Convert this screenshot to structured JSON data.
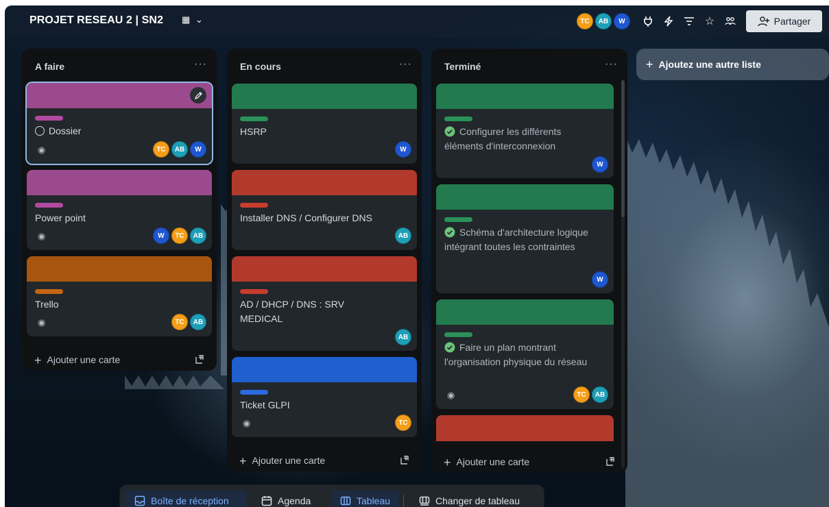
{
  "header": {
    "board_title": "PROJET RESEAU 2 | SN2",
    "members": [
      {
        "initials": "TC",
        "color": "#f59e17"
      },
      {
        "initials": "AB",
        "color": "#1e9fb8"
      },
      {
        "initials": "W",
        "color": "#1f57d1"
      }
    ],
    "share_label": "Partager"
  },
  "lists": [
    {
      "title": "A faire",
      "add_card_label": "Ajouter une carte",
      "cards": [
        {
          "title": "Dossier",
          "cover": "#9c4a8e",
          "label": "#b04aa0",
          "members": [
            "TC",
            "AB",
            "W"
          ]
        },
        {
          "title": "Power point",
          "cover": "#9c4a8e",
          "label": "#b04aa0",
          "members": [
            "W",
            "TC",
            "AB"
          ]
        },
        {
          "title": "Trello",
          "cover": "#a8560f",
          "label": "#c46412",
          "members": [
            "TC",
            "AB"
          ]
        }
      ]
    },
    {
      "title": "En cours",
      "add_card_label": "Ajouter une carte",
      "cards": [
        {
          "title": "HSRP",
          "cover": "#227a4e",
          "label": "#2a9158",
          "members": [
            "W"
          ]
        },
        {
          "title": "Installer DNS / Configurer DNS",
          "cover": "#b13a2d",
          "label": "#c73d2e",
          "members": [
            "AB"
          ]
        },
        {
          "title": "AD / DHCP / DNS : SRV MEDICAL",
          "cover": "#b13a2d",
          "label": "#c73d2e",
          "members": [
            "AB"
          ]
        },
        {
          "title": "Ticket GLPI",
          "cover": "#1f5fce",
          "label": "#2b6ae0",
          "members": [
            "TC"
          ]
        }
      ]
    },
    {
      "title": "Terminé",
      "add_card_label": "Ajouter une carte",
      "cards": [
        {
          "title": "Configurer les différents éléments d'interconnexion",
          "cover": "#227a4e",
          "label": "#2a9158",
          "members": [
            "W"
          ]
        },
        {
          "title": "Schéma d'architecture logique intégrant toutes les contraintes",
          "cover": "#227a4e",
          "label": "#2a9158",
          "members": [
            "W"
          ]
        },
        {
          "title": "Faire un plan montrant l'organisation physique du réseau",
          "cover": "#227a4e",
          "label": "#2a9158",
          "members": [
            "TC",
            "AB"
          ]
        },
        {
          "cover": "#b13a2d"
        }
      ]
    }
  ],
  "add_list_label": "Ajoutez une autre liste",
  "bottom_bar": {
    "inbox": "Boîte de réception",
    "agenda": "Agenda",
    "board": "Tableau",
    "switch_board": "Changer de tableau"
  }
}
